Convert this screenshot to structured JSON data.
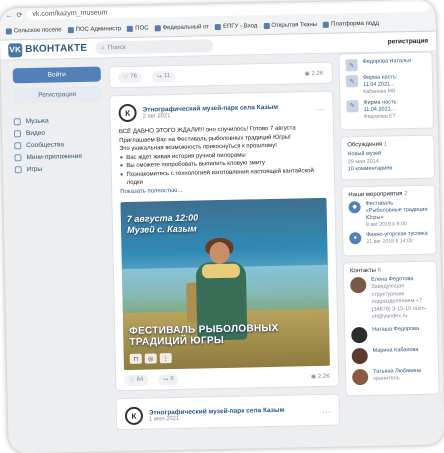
{
  "browser": {
    "url": "vk.com/kazym_museum",
    "right_text": "☆ ≡ ⟳ ⊕",
    "bookmarks": [
      {
        "label": "Сельское поселе"
      },
      {
        "label": "ПОС Администр"
      },
      {
        "label": "ПОС"
      },
      {
        "label": "Федеральный от"
      },
      {
        "label": "ЕПГУ - Вход"
      },
      {
        "label": "Открытая Тканы"
      },
      {
        "label": "Платформа подд"
      }
    ]
  },
  "header": {
    "logo_mark": "VK",
    "logo_text": "ВКОНТАКТЕ",
    "search_placeholder": "Поиск",
    "register_link": "регистрация"
  },
  "left": {
    "login_button": "Войти",
    "register_button": "Регистрация",
    "nav": [
      {
        "label": "Музыка"
      },
      {
        "label": "Видео"
      },
      {
        "label": "Сообщества"
      },
      {
        "label": "Мини-приложения"
      },
      {
        "label": "Игры"
      }
    ]
  },
  "feed": {
    "top_card": {
      "likes": "76",
      "shares": "11",
      "views": "2.2K"
    },
    "post": {
      "author": "Этнографический музей-парк села Казым",
      "date": "2 авг 2021",
      "lines": [
        "ВСЁ ДАВНО ЭТОГО ЖДАЛИ!!! оно случилось! Готово 7 августа Приглашаем Вас на Фестиваль рыболовных традиций Югры!",
        "Это уникальная возможность прикоснуться к прошлому!"
      ],
      "bullets": [
        "Вас ждет живая история ручной пилорамы",
        "Вы сможете попробовать выпилить кловую змиту",
        "Познакомитесь с технологией изготовления настоящей кантайской лодки"
      ],
      "more": "Показать полностью...",
      "overlay_date": "7 августа 12:00",
      "overlay_place": "Музей с. Казым",
      "banner": "ФЕСТИВАЛЬ РЫБОЛОВНЫХ ТРАДИЦИЙ ЮГРЫ",
      "likes": "84",
      "shares": "6",
      "views": "2.2K"
    },
    "next_post": {
      "author": "Этнографический музей-парк села Казым",
      "date": "1 июл 2021"
    }
  },
  "right": {
    "notes": [
      {
        "title": "Федорова Наталья",
        "sub": ""
      },
      {
        "title": "Фирма насть: 11.04.2021...",
        "sub": "Кабанова МВ"
      },
      {
        "title": "Фирма насть: 11.04.2021...",
        "sub": "Федорова ЕТ"
      }
    ],
    "discussions_title": "Обсуждения",
    "discussions_count": "1",
    "discussion": {
      "title": "Новый музей",
      "date": "29 мая 2014",
      "comments": "10 комментариев"
    },
    "events_title": "Наши мероприятия",
    "events_count": "2",
    "events": [
      {
        "title": "Фестиваль «Рыболовные традиции Югры»",
        "date": "8 авг 2019 в 9:00"
      },
      {
        "title": "Финно-угорская тусовка",
        "date": "21 авг 2018 в 14:00"
      }
    ],
    "contacts_title": "Контакты",
    "contacts_count": "6",
    "contacts": [
      {
        "name": "Елена Федотова",
        "sub": "Заведующая структурным подразделением +7 (34678) 3-15-10 nuzn-sh@yandex.ru"
      },
      {
        "name": "Наташа Федорова",
        "sub": ""
      },
      {
        "name": "Марина Кабанова",
        "sub": ""
      },
      {
        "name": "Татьяна Любавина",
        "sub": "хранитель"
      }
    ]
  }
}
